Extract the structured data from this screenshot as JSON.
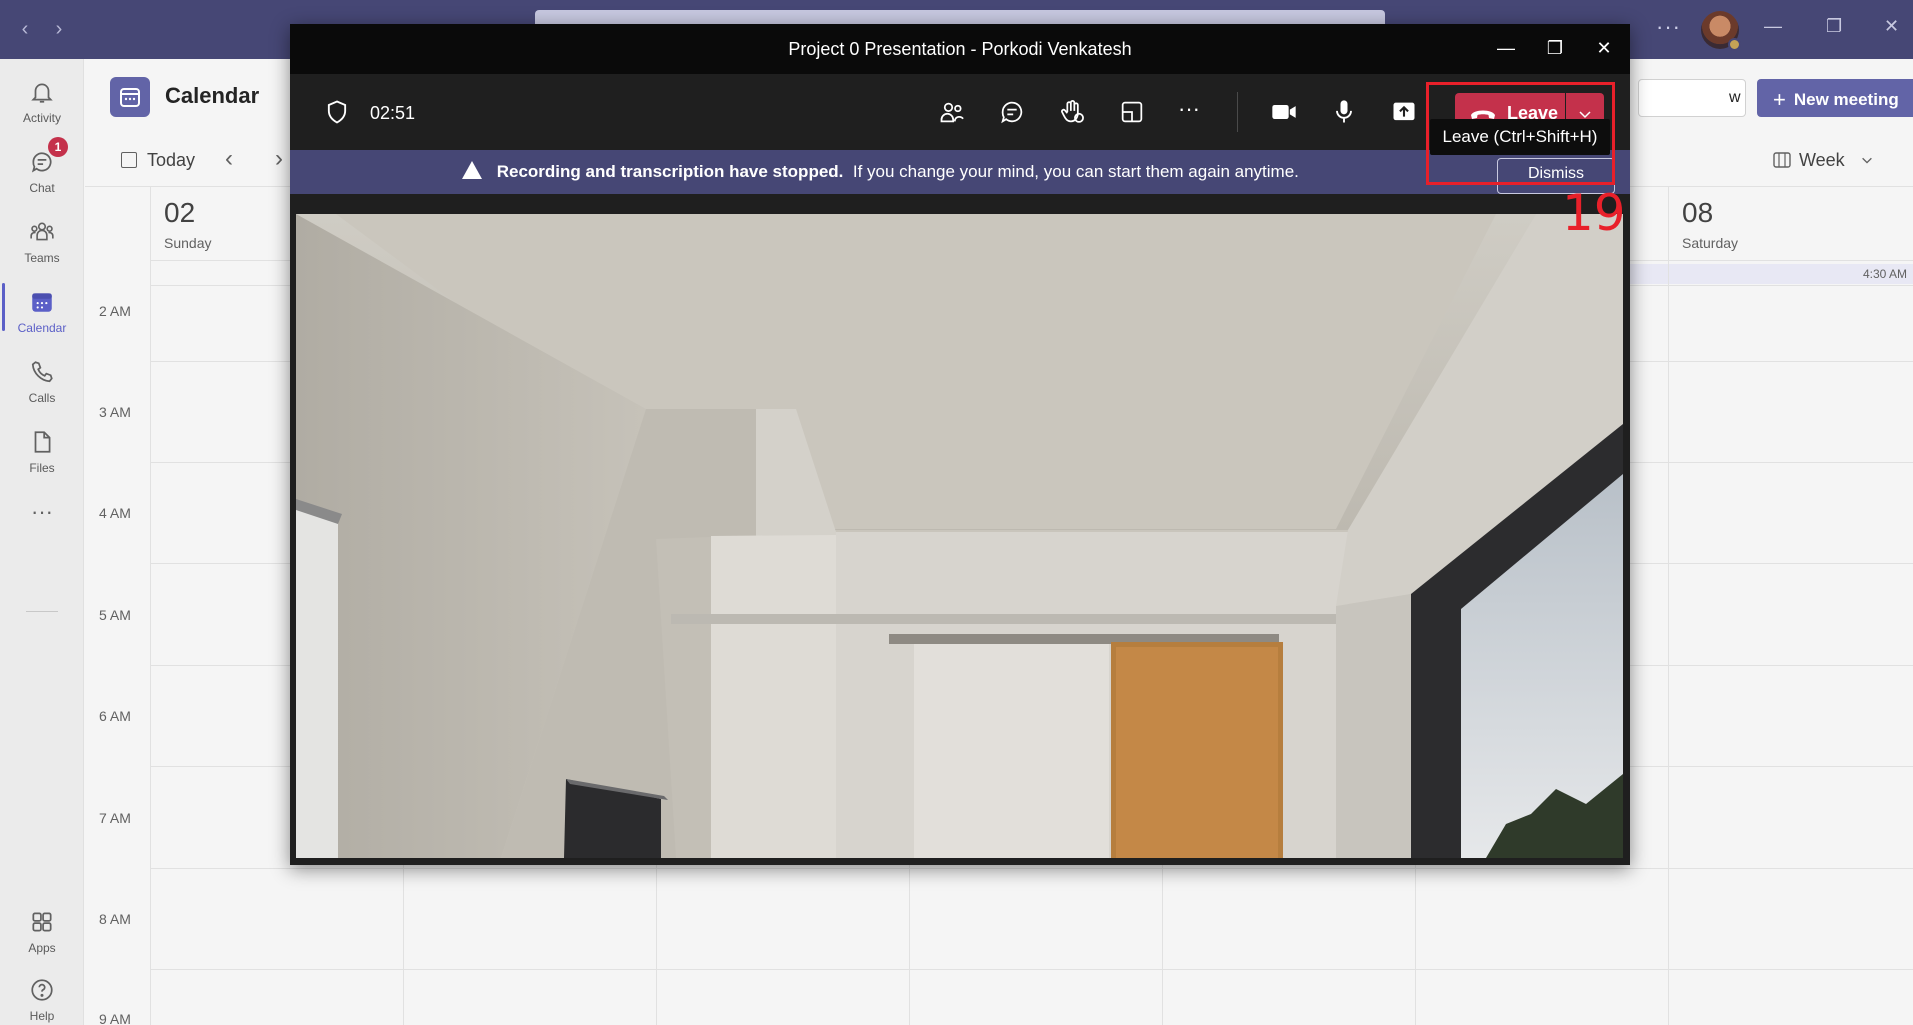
{
  "app": {
    "nav_back": "‹",
    "nav_forward": "›",
    "more_label": "···"
  },
  "rail": {
    "items": [
      {
        "label": "Activity",
        "icon": "bell-icon"
      },
      {
        "label": "Chat",
        "icon": "chat-icon",
        "badge": "1"
      },
      {
        "label": "Teams",
        "icon": "teams-icon"
      },
      {
        "label": "Calendar",
        "icon": "calendar-icon",
        "active": true
      },
      {
        "label": "Calls",
        "icon": "phone-icon"
      },
      {
        "label": "Files",
        "icon": "file-icon"
      }
    ],
    "more": "···",
    "apps_label": "Apps",
    "help_label": "Help"
  },
  "calendar": {
    "title": "Calendar",
    "partial_button": "w",
    "new_meeting": "New meeting",
    "today": "Today",
    "view": "Week",
    "days": [
      {
        "num": "02",
        "name": "Sunday"
      },
      {
        "num": "08",
        "name": "Saturday"
      }
    ],
    "allday_time": "4:30 AM",
    "times": [
      "2 AM",
      "3 AM",
      "4 AM",
      "5 AM",
      "6 AM",
      "7 AM",
      "8 AM",
      "9 AM"
    ]
  },
  "meeting": {
    "window_title": "Project 0 Presentation - Porkodi Venkatesh",
    "timer": "02:51",
    "leave_label": "Leave",
    "leave_tooltip": "Leave (Ctrl+Shift+H)",
    "banner_bold": "Recording and transcription have stopped.",
    "banner_text": "If you change your mind, you can start them again anytime.",
    "dismiss_label": "Dismiss"
  },
  "annotation": {
    "number": "19",
    "color": "#e8202a"
  },
  "colors": {
    "brand": "#464775",
    "accent": "#6264a7",
    "leave": "#c4314b"
  }
}
